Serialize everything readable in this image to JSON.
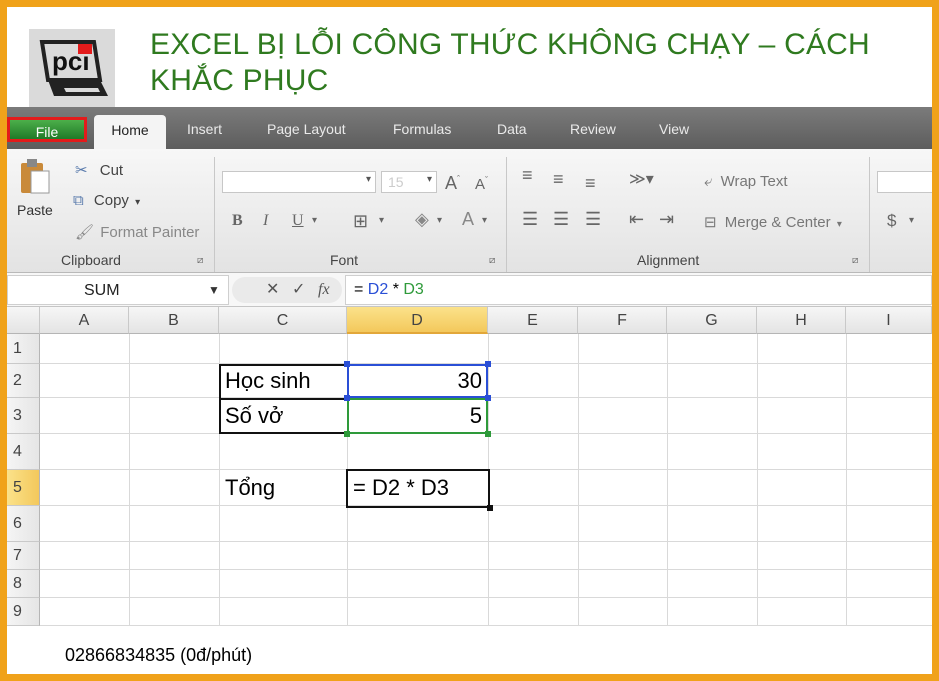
{
  "header": {
    "title": "EXCEL BỊ LỖI CÔNG THỨC KHÔNG CHẠY – CÁCH KHẮC PHỤC",
    "logo_text": "pci"
  },
  "tabs": [
    "File",
    "Home",
    "Insert",
    "Page Layout",
    "Formulas",
    "Data",
    "Review",
    "View"
  ],
  "ribbon": {
    "clipboard": {
      "paste": "Paste",
      "cut": "Cut",
      "copy": "Copy",
      "format_painter": "Format Painter",
      "label": "Clipboard"
    },
    "font": {
      "size": "15",
      "label": "Font"
    },
    "alignment": {
      "wrap_text": "Wrap Text",
      "merge_center": "Merge & Center",
      "label": "Alignment"
    },
    "number": {
      "currency": "$"
    }
  },
  "formula_bar": {
    "name_box": "SUM",
    "fx": "fx",
    "formula": "= D2 * D3"
  },
  "columns": [
    "A",
    "B",
    "C",
    "D",
    "E",
    "F",
    "G",
    "H",
    "I"
  ],
  "rows": [
    "1",
    "2",
    "3",
    "4",
    "5",
    "6",
    "7",
    "8",
    "9"
  ],
  "cells": {
    "C2": "Học  sinh",
    "D2": "30",
    "C3": "Số vở",
    "D3": "5",
    "C5": "Tổng",
    "D5": "= D2 * D3"
  },
  "footer": {
    "phone": "02866834835 (0đ/phút)"
  },
  "colors": {
    "border": "#f0a21a",
    "title": "#2f7a1f",
    "file_tab": "#2e8b34",
    "highlight": "#e31b1b"
  }
}
